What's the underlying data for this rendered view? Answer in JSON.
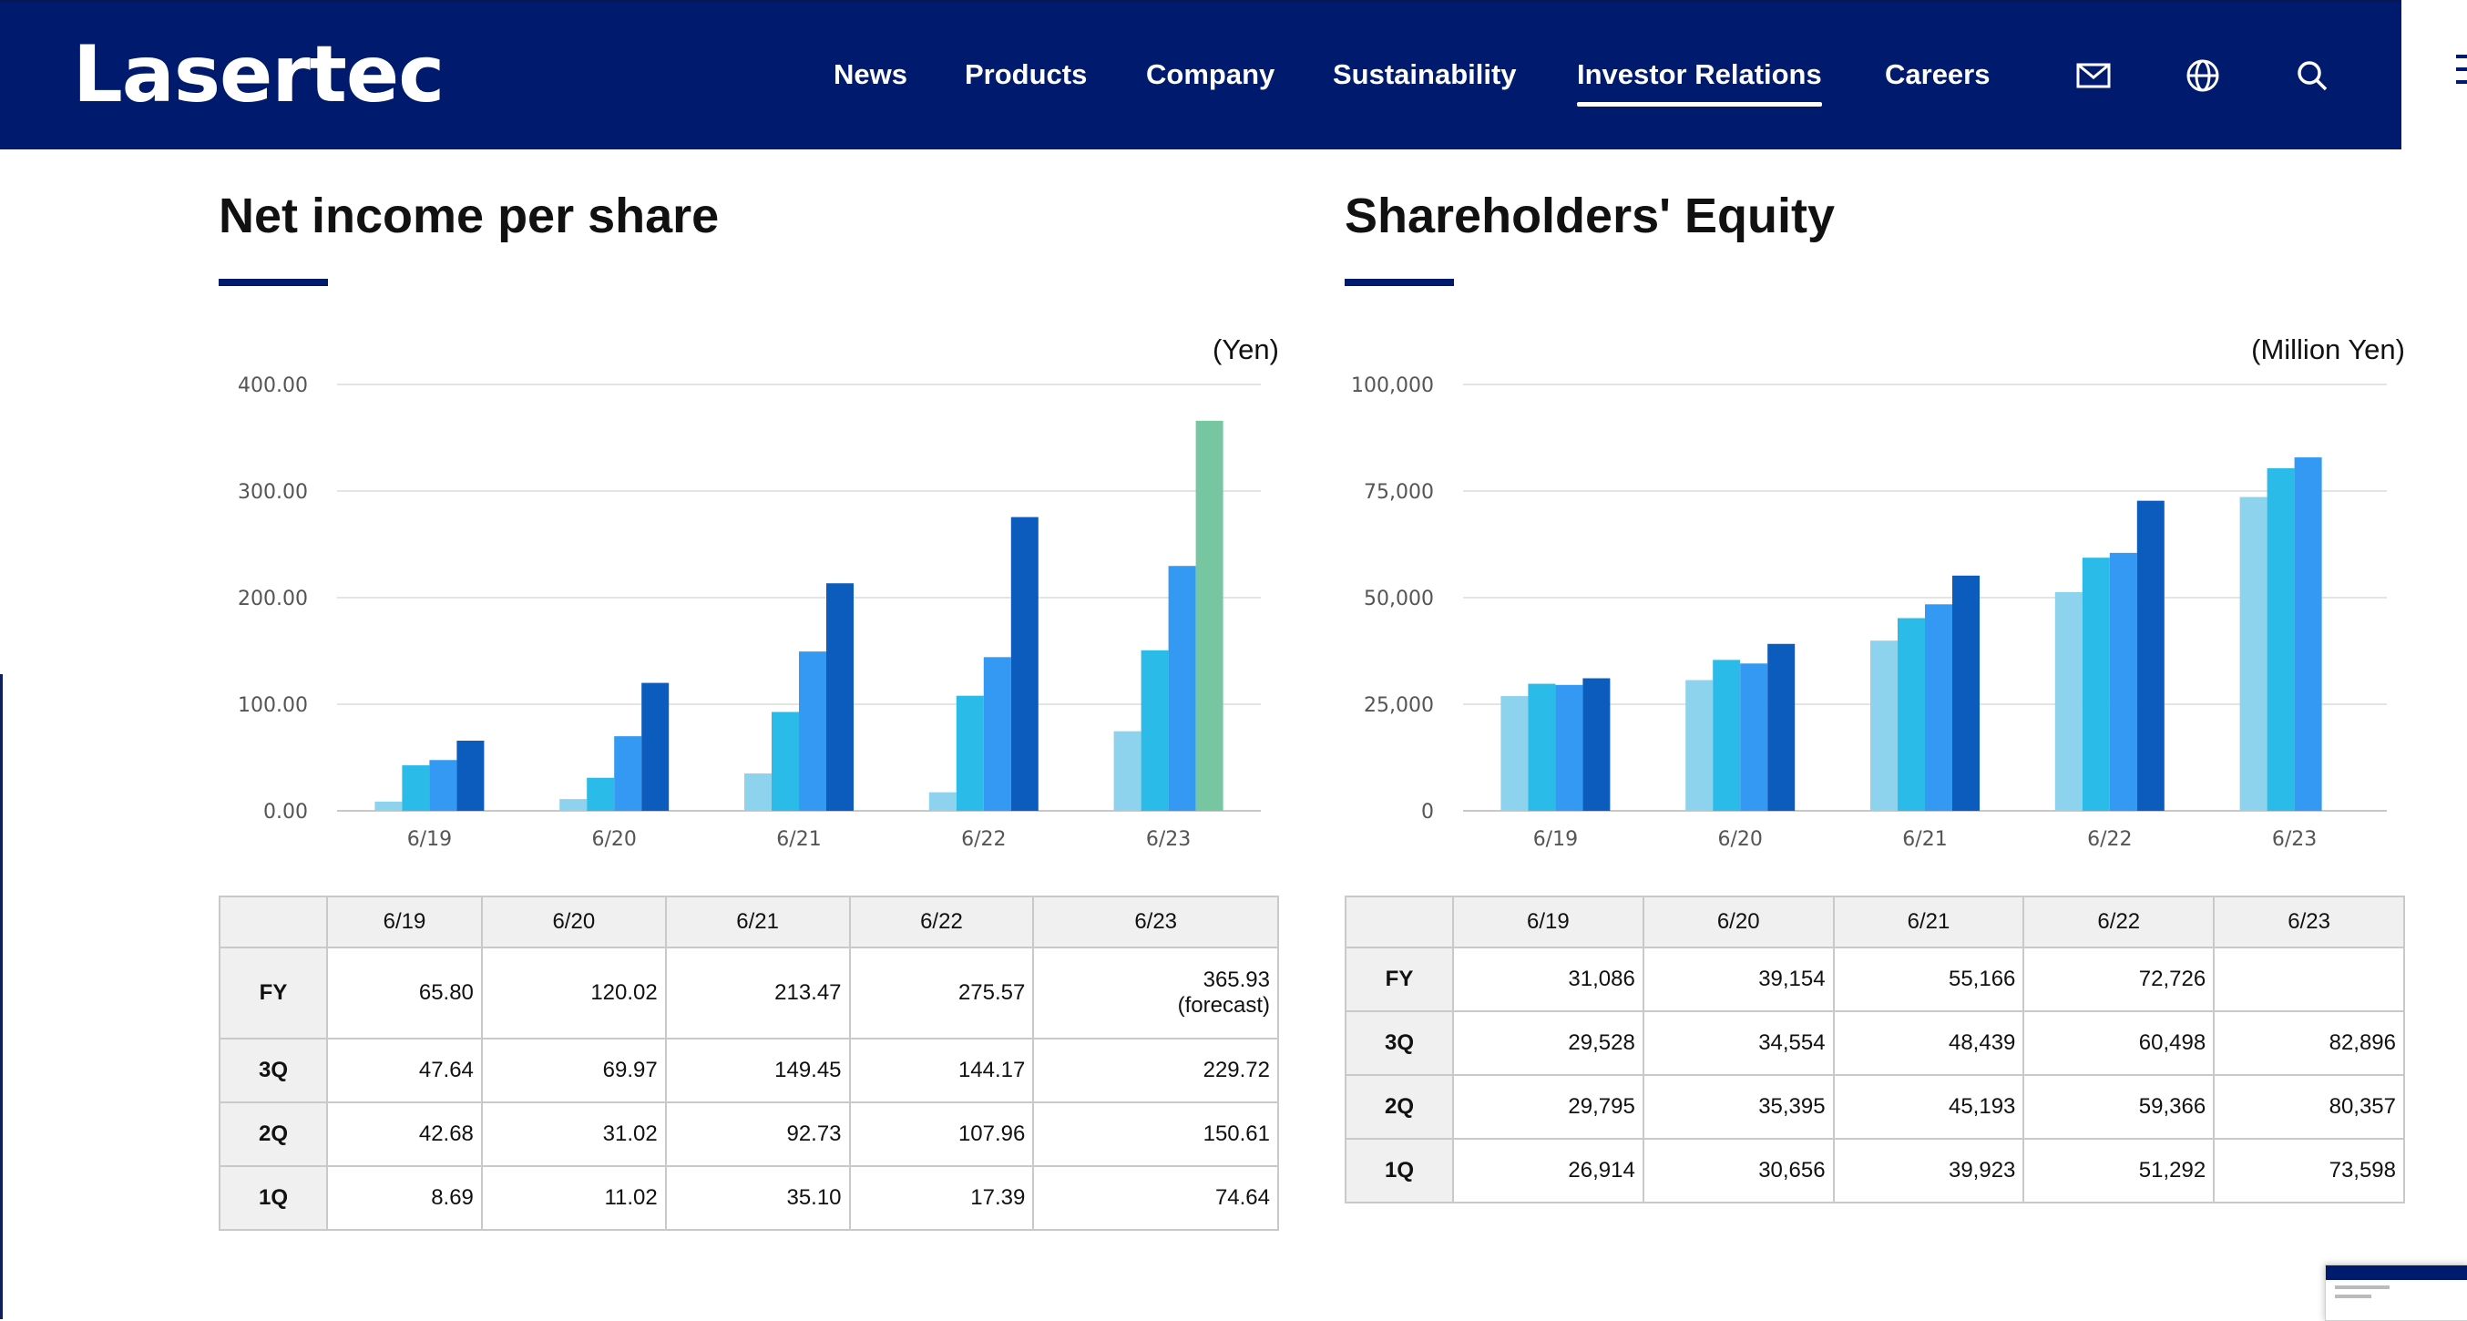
{
  "header": {
    "logo": "Lasertec",
    "nav": [
      "News",
      "Products",
      "Company",
      "Sustainability",
      "Investor Relations",
      "Careers"
    ],
    "active_nav": "Investor Relations",
    "icons": [
      "mail-icon",
      "globe-icon",
      "search-icon",
      "menu-icon"
    ]
  },
  "colors": {
    "brand_navy": "#001a6e",
    "q1": "#8dd3ee",
    "q2": "#2bbbe8",
    "q3": "#3399f3",
    "fy": "#0b5cbd",
    "forecast": "#76c7a1"
  },
  "sections": [
    {
      "title": "Net income per share",
      "unit": "(Yen)",
      "table": {
        "columns": [
          "6/19",
          "6/20",
          "6/21",
          "6/22",
          "6/23"
        ],
        "rows": [
          {
            "label": "FY",
            "values": [
              "65.80",
              "120.02",
              "213.47",
              "275.57",
              "365.93"
            ],
            "note": "(forecast)"
          },
          {
            "label": "3Q",
            "values": [
              "47.64",
              "69.97",
              "149.45",
              "144.17",
              "229.72"
            ]
          },
          {
            "label": "2Q",
            "values": [
              "42.68",
              "31.02",
              "92.73",
              "107.96",
              "150.61"
            ]
          },
          {
            "label": "1Q",
            "values": [
              "8.69",
              "11.02",
              "35.10",
              "17.39",
              "74.64"
            ]
          }
        ]
      }
    },
    {
      "title": "Shareholders' Equity",
      "unit": "(Million Yen)",
      "table": {
        "columns": [
          "6/19",
          "6/20",
          "6/21",
          "6/22",
          "6/23"
        ],
        "rows": [
          {
            "label": "FY",
            "values": [
              "31,086",
              "39,154",
              "55,166",
              "72,726",
              ""
            ]
          },
          {
            "label": "3Q",
            "values": [
              "29,528",
              "34,554",
              "48,439",
              "60,498",
              "82,896"
            ]
          },
          {
            "label": "2Q",
            "values": [
              "29,795",
              "35,395",
              "45,193",
              "59,366",
              "80,357"
            ]
          },
          {
            "label": "1Q",
            "values": [
              "26,914",
              "30,656",
              "39,923",
              "51,292",
              "73,598"
            ]
          }
        ]
      }
    }
  ],
  "chart_data": [
    {
      "type": "bar",
      "categories": [
        "6/19",
        "6/20",
        "6/21",
        "6/22",
        "6/23"
      ],
      "y_ticks": [
        "0.00",
        "100.00",
        "200.00",
        "300.00",
        "400.00"
      ],
      "ylim": [
        0,
        400
      ],
      "series": [
        {
          "values": [
            8.69,
            11.02,
            35.1,
            17.39,
            74.64
          ]
        },
        {
          "values": [
            42.68,
            31.02,
            92.73,
            107.96,
            150.61
          ]
        },
        {
          "values": [
            47.64,
            69.97,
            149.45,
            144.17,
            229.72
          ]
        },
        {
          "values": [
            65.8,
            120.02,
            213.47,
            275.57,
            365.93
          ]
        }
      ],
      "forecast_index": 4,
      "grid": true
    },
    {
      "type": "bar",
      "categories": [
        "6/19",
        "6/20",
        "6/21",
        "6/22",
        "6/23"
      ],
      "y_ticks": [
        "0",
        "25,000",
        "50,000",
        "75,000",
        "100,000"
      ],
      "ylim": [
        0,
        100000
      ],
      "series": [
        {
          "values": [
            26914,
            30656,
            39923,
            51292,
            73598
          ]
        },
        {
          "values": [
            29795,
            35395,
            45193,
            59366,
            80357
          ]
        },
        {
          "values": [
            29528,
            34554,
            48439,
            60498,
            82896
          ]
        },
        {
          "values": [
            31086,
            39154,
            55166,
            72726,
            null
          ]
        }
      ],
      "grid": true
    }
  ]
}
